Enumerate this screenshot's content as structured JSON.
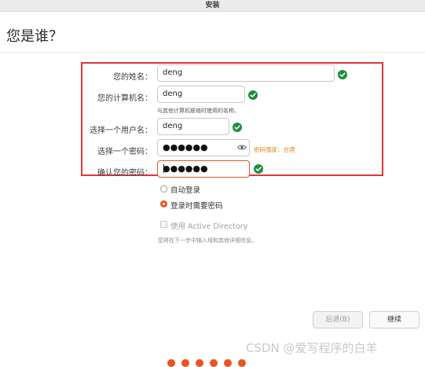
{
  "window": {
    "title": "安装"
  },
  "page": {
    "heading": "您是谁？"
  },
  "form": {
    "name_label": "您的姓名：",
    "name_value": "deng",
    "computer_label": "您的计算机名：",
    "computer_value": "deng",
    "computer_hint": "与其他计算机联络时使用的名称。",
    "username_label": "选择一个用户名：",
    "username_value": "deng",
    "password_label": "选择一个密码：",
    "password_value": "●●●●●●",
    "password_strength": "密码强度：合理",
    "confirm_label": "确认您的密码：",
    "confirm_value": "●●●●●●"
  },
  "login": {
    "auto_login_label": "自动登录",
    "require_password_label": "登录时需要密码",
    "selected": "require_password",
    "active_directory_label": "使用 Active Directory",
    "active_directory_note": "您将在下一步中输入域和其他详细信息。"
  },
  "buttons": {
    "back_label": "后退(B)",
    "continue_label": "继续"
  },
  "watermark": "CSDN @爱写程序的白羊",
  "progress": {
    "total_dots": 6
  },
  "colors": {
    "accent": "#e95420",
    "success": "#1e8d3d",
    "highlight": "#e0363b",
    "strength": "#e0881a"
  },
  "icons": {
    "valid": "check-circle-icon",
    "reveal": "eye-icon"
  }
}
